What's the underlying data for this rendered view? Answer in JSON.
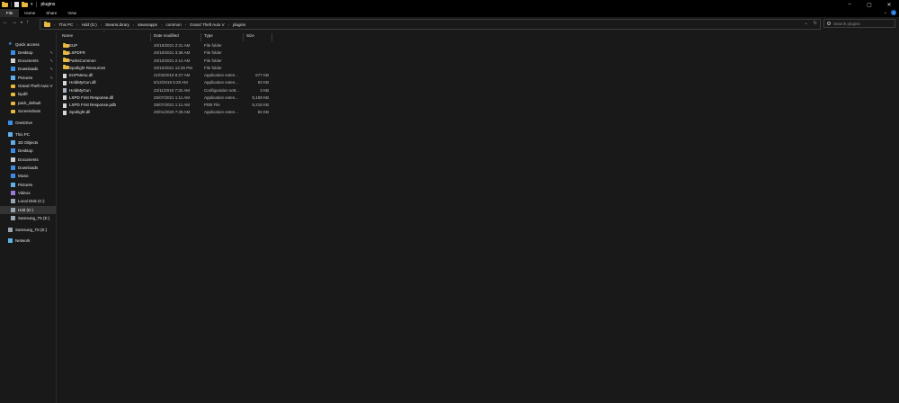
{
  "window": {
    "title": "plugins",
    "controls": [
      "–",
      "▢",
      "✕"
    ]
  },
  "ribbon": {
    "tabs": [
      "File",
      "Home",
      "Share",
      "View"
    ]
  },
  "address": {
    "crumbs": [
      "This PC",
      "Hdd (D:)",
      "SteamLibrary",
      "steamapps",
      "common",
      "Grand Theft Auto V",
      "plugins"
    ],
    "search_placeholder": "Search plugins"
  },
  "sidebar": {
    "items": [
      {
        "label": "Quick access",
        "icon": "star-icon",
        "color": "#4aa3ff",
        "indent": 0,
        "pinned": false
      },
      {
        "label": "Desktop",
        "icon": "desktop-icon",
        "color": "#3b8ee8",
        "indent": 1,
        "pinned": true
      },
      {
        "label": "Documents",
        "icon": "documents-icon",
        "color": "#cfcfcf",
        "indent": 1,
        "pinned": true
      },
      {
        "label": "Downloads",
        "icon": "downloads-icon",
        "color": "#3b8ee8",
        "indent": 1,
        "pinned": true
      },
      {
        "label": "Pictures",
        "icon": "pictures-icon",
        "color": "#5fb0e8",
        "indent": 1,
        "pinned": true
      },
      {
        "label": "Grand Theft Auto V",
        "icon": "folder-icon",
        "color": "#e8b93e",
        "indent": 1,
        "pinned": false
      },
      {
        "label": "lspdfr",
        "icon": "folder-icon",
        "color": "#e8b93e",
        "indent": 1,
        "pinned": false
      },
      {
        "label": "pack_default",
        "icon": "folder-icon",
        "color": "#e8b93e",
        "indent": 1,
        "pinned": false
      },
      {
        "label": "Screenshots",
        "icon": "folder-icon",
        "color": "#e8b93e",
        "indent": 1,
        "pinned": false
      },
      {
        "label": "OneDrive",
        "icon": "cloud-icon",
        "color": "#3b8ee8",
        "indent": 0,
        "pinned": false
      },
      {
        "label": "This PC",
        "icon": "pc-icon",
        "color": "#5fb0e8",
        "indent": 0,
        "pinned": false
      },
      {
        "label": "3D Objects",
        "icon": "3d-objects-icon",
        "color": "#5fb0e8",
        "indent": 1,
        "pinned": false
      },
      {
        "label": "Desktop",
        "icon": "desktop-icon",
        "color": "#3b8ee8",
        "indent": 1,
        "pinned": false
      },
      {
        "label": "Documents",
        "icon": "documents-icon",
        "color": "#cfcfcf",
        "indent": 1,
        "pinned": false
      },
      {
        "label": "Downloads",
        "icon": "downloads-icon",
        "color": "#3b8ee8",
        "indent": 1,
        "pinned": false
      },
      {
        "label": "Music",
        "icon": "music-icon",
        "color": "#3b8ee8",
        "indent": 1,
        "pinned": false
      },
      {
        "label": "Pictures",
        "icon": "pictures-icon",
        "color": "#5fb0e8",
        "indent": 1,
        "pinned": false
      },
      {
        "label": "Videos",
        "icon": "videos-icon",
        "color": "#9a7ad8",
        "indent": 1,
        "pinned": false
      },
      {
        "label": "Local Disk (C:)",
        "icon": "drive-icon",
        "color": "#9aa5b1",
        "indent": 1,
        "pinned": false
      },
      {
        "label": "Hdd (D:)",
        "icon": "drive-icon",
        "color": "#9aa5b1",
        "indent": 1,
        "pinned": false,
        "selected": true
      },
      {
        "label": "Samsung_T5 (E:)",
        "icon": "drive-icon",
        "color": "#9aa5b1",
        "indent": 1,
        "pinned": false
      },
      {
        "label": "Samsung_T5 (E:)",
        "icon": "drive-icon",
        "color": "#9aa5b1",
        "indent": 0,
        "pinned": false
      },
      {
        "label": "Network",
        "icon": "network-icon",
        "color": "#5fb0e8",
        "indent": 0,
        "pinned": false
      }
    ]
  },
  "columns": {
    "name": "Name",
    "date": "Date modified",
    "type": "Type",
    "size": "Size"
  },
  "files": [
    {
      "name": "EUP",
      "date": "20/10/2021 2:31 AM",
      "type": "File folder",
      "size": "",
      "icon": "folder-icon"
    },
    {
      "name": "LSPDFR",
      "date": "20/10/2021 3:36 AM",
      "type": "File folder",
      "size": "",
      "icon": "folder-icon"
    },
    {
      "name": "ParksCommon",
      "date": "20/10/2021 2:14 AM",
      "type": "File folder",
      "size": "",
      "icon": "folder-icon"
    },
    {
      "name": "Spotlight Resources",
      "date": "20/10/2021 12:25 PM",
      "type": "File folder",
      "size": "",
      "icon": "folder-icon"
    },
    {
      "name": "EUPMenu.dll",
      "date": "21/03/2019 9:27 AM",
      "type": "Application exten...",
      "size": "677 KB",
      "icon": "file-icon"
    },
    {
      "name": "HoldMyGun.dll",
      "date": "5/12/2018 5:28 AM",
      "type": "Application exten...",
      "size": "93 KB",
      "icon": "file-icon"
    },
    {
      "name": "HoldMyGun",
      "date": "22/11/2018 7:32 AM",
      "type": "Configuration sett...",
      "size": "3 KB",
      "icon": "config-file-icon"
    },
    {
      "name": "LSPD First Response.dll",
      "date": "25/07/2021 1:11 AM",
      "type": "Application exten...",
      "size": "5,159 KB",
      "icon": "file-icon"
    },
    {
      "name": "LSPD First Response.pdb",
      "date": "25/07/2021 1:11 AM",
      "type": "PDB File",
      "size": "5,218 KB",
      "icon": "file-icon"
    },
    {
      "name": "Spotlight.dll",
      "date": "20/01/2020 7:28 AM",
      "type": "Application exten...",
      "size": "84 KB",
      "icon": "file-icon"
    }
  ],
  "colors": {
    "folder": "#e8b93e",
    "accent": "#1e73d8",
    "background": "#191919"
  }
}
